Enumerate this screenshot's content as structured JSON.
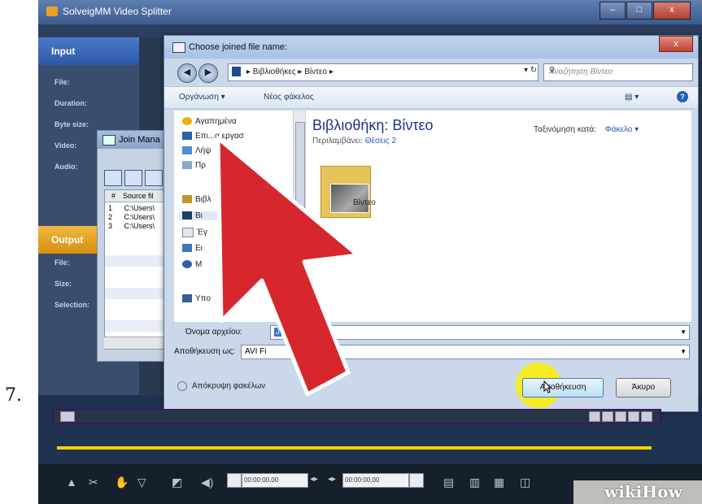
{
  "step_number": "7.",
  "app": {
    "title": "SolveigMM Video Splitter",
    "window_buttons": [
      "–",
      "□",
      "x"
    ],
    "input_panel": {
      "header": "Input",
      "fields": [
        "File:",
        "Duration:",
        "Byte size:",
        "Video:",
        "Audio:"
      ]
    },
    "output_panel": {
      "header": "Output",
      "fields": [
        "File:",
        "Size:",
        "Selection:"
      ]
    }
  },
  "join_manager": {
    "title": "Join Mana",
    "columns": [
      "#",
      "Source fil"
    ],
    "rows": [
      {
        "num": "1",
        "path": "C:\\Users\\"
      },
      {
        "num": "2",
        "path": "C:\\Users\\"
      },
      {
        "num": "3",
        "path": "C:\\Users\\"
      }
    ]
  },
  "dialog": {
    "title": "Choose joined file name:",
    "close_label": "x",
    "breadcrumb": "▸ Βιβλιοθήκες ▸ Βίντεο ▸",
    "search_placeholder": "Αναζήτηση Βίντεο",
    "command_bar": {
      "organize": "Οργάνωση ▾",
      "new_folder": "Νέος φάκελος"
    },
    "nav_items": [
      "Αγαπημένα",
      "Επι...α εργασ",
      "Λήψ",
      "Πρ",
      "Βιβλ",
      "Βι",
      "Έγ",
      "Ει",
      "Μ",
      "Υπο"
    ],
    "library_title": "Βιβλιοθήκη: Βίντεο",
    "library_sub": "Περιλαμβάνει:",
    "library_sub_link": "Θέσεις 2",
    "arrange_label": "Ταξινόμηση κατά:",
    "arrange_value": "Φάκελο ▾",
    "folder_label": "Βίντεο",
    "filename_label": "Όνομα αρχείου:",
    "filename_value": "J",
    "saveas_label": "Αποθήκευση ως:",
    "saveas_value": "AVI Fi",
    "hide_folders": "Απόκρυψη φακέλων",
    "save_button": "Αποθήκευση",
    "cancel_button": "Άκυρο"
  },
  "toolbar": {
    "time_start": "00:00:00,00",
    "time_end": "00:00:00,00"
  },
  "watermark": {
    "text": "wikiHow"
  },
  "colors": {
    "arrow": "#d8262e",
    "highlight": "#ffee00",
    "progress": "#f2d300"
  }
}
